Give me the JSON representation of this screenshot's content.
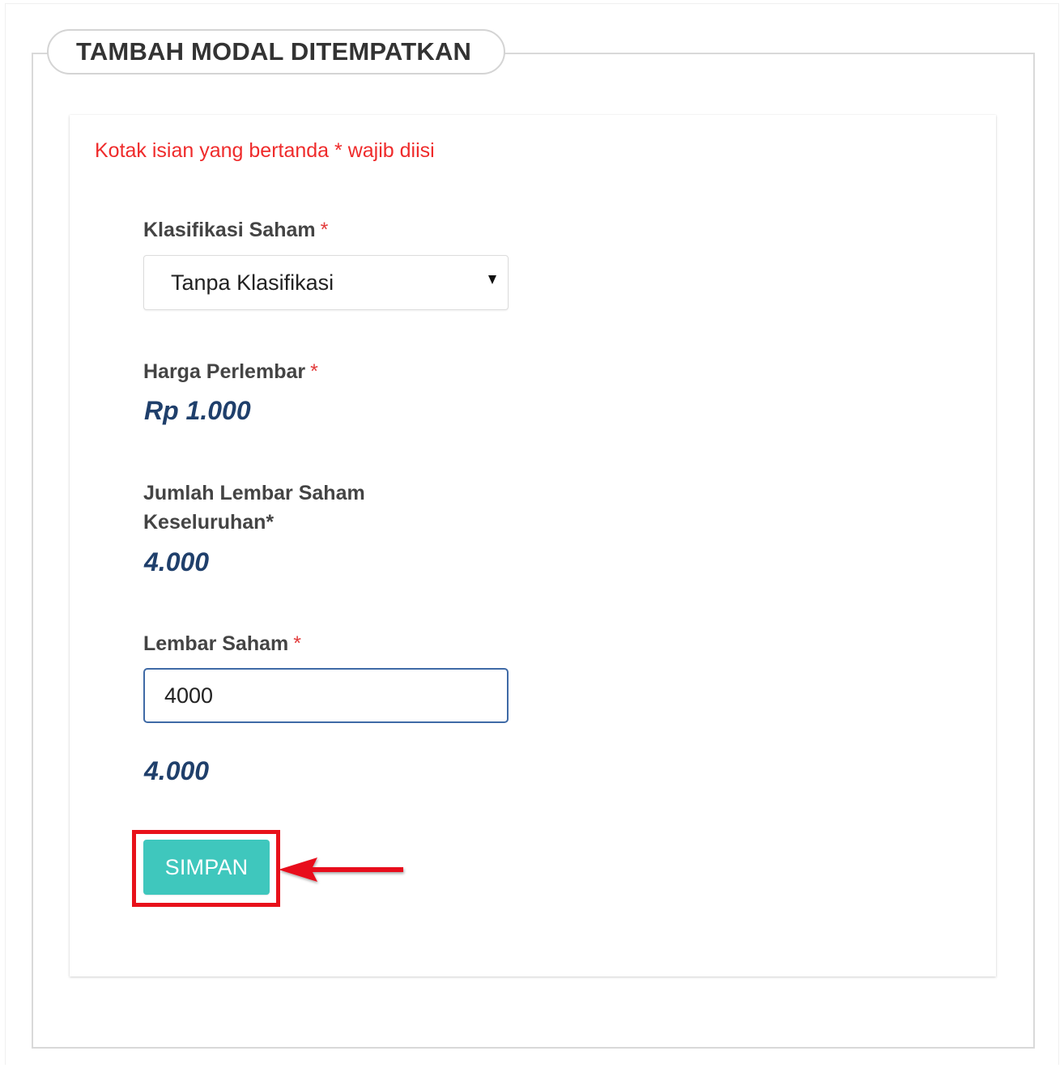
{
  "form": {
    "title": "TAMBAH MODAL DITEMPATKAN",
    "required_note": "Kotak isian yang bertanda * wajib diisi",
    "required_marker": "*"
  },
  "fields": {
    "klasifikasi": {
      "label": "Klasifikasi Saham",
      "selected": "Tanpa Klasifikasi"
    },
    "harga": {
      "label": "Harga Perlembar",
      "value": "Rp 1.000"
    },
    "jumlah": {
      "label_line1": "Jumlah Lembar Saham",
      "label_line2": "Keseluruhan*",
      "value": "4.000"
    },
    "lembar": {
      "label": "Lembar Saham",
      "input_value": "4000",
      "formatted": "4.000"
    }
  },
  "actions": {
    "save_label": "SIMPAN"
  },
  "colors": {
    "required_text": "#ef2b2b",
    "value_text": "#1f3f6b",
    "button": "#3fc7bd",
    "highlight": "#e8111a"
  }
}
